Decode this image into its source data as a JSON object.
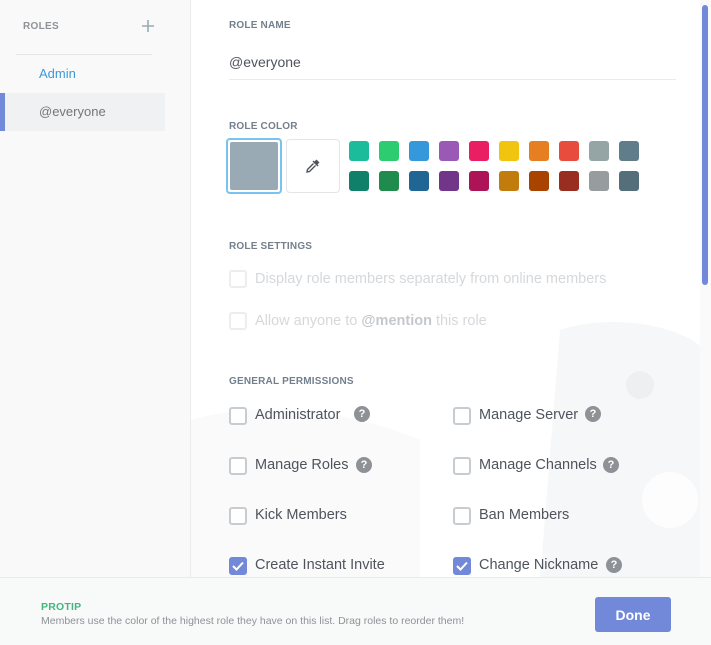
{
  "sidebar": {
    "title": "ROLES",
    "add_icon": "plus-icon",
    "roles": [
      {
        "label": "Admin",
        "color": "#3c9ad6"
      },
      {
        "label": "@everyone",
        "color": "#72767d",
        "selected": true
      }
    ]
  },
  "main": {
    "role_name": {
      "title": "ROLE NAME",
      "value": "@everyone"
    },
    "role_color": {
      "title": "ROLE COLOR",
      "default_color": "#99aab5",
      "picker_icon": "eyedropper-icon",
      "swatches_top": [
        "#1abc9c",
        "#2ecc71",
        "#3498db",
        "#9b59b6",
        "#e91e63",
        "#f1c40f",
        "#e67e22",
        "#e74c3c",
        "#95a5a6",
        "#607d8b"
      ],
      "swatches_bottom": [
        "#11806a",
        "#1f8b4c",
        "#206694",
        "#71368a",
        "#ad1457",
        "#c27c0e",
        "#a84300",
        "#992d22",
        "#979c9f",
        "#546e7a"
      ]
    },
    "role_settings": {
      "title": "ROLE SETTINGS",
      "hoist": {
        "label": "Display role members separately from online members"
      },
      "mentionable": {
        "prefix": "Allow anyone to ",
        "mention": "@mention",
        "suffix": " this role"
      }
    },
    "general_permissions": {
      "title": "GENERAL PERMISSIONS",
      "items": [
        {
          "label": "Administrator",
          "checked": false,
          "help": true
        },
        {
          "label": "Manage Server",
          "checked": false,
          "help": true
        },
        {
          "label": "Manage Roles",
          "checked": false,
          "help": true
        },
        {
          "label": "Manage Channels",
          "checked": false,
          "help": true
        },
        {
          "label": "Kick Members",
          "checked": false,
          "help": false
        },
        {
          "label": "Ban Members",
          "checked": false,
          "help": false
        },
        {
          "label": "Create Instant Invite",
          "checked": true,
          "help": false
        },
        {
          "label": "Change Nickname",
          "checked": true,
          "help": true
        }
      ],
      "help_glyph": "?"
    }
  },
  "footer": {
    "protip_label": "PROTIP",
    "protip_text": "Members use the color of the highest role they have on this list. Drag roles to reorder them!",
    "done_label": "Done"
  },
  "colors": {
    "accent": "#7289da",
    "protip": "#43b581"
  }
}
